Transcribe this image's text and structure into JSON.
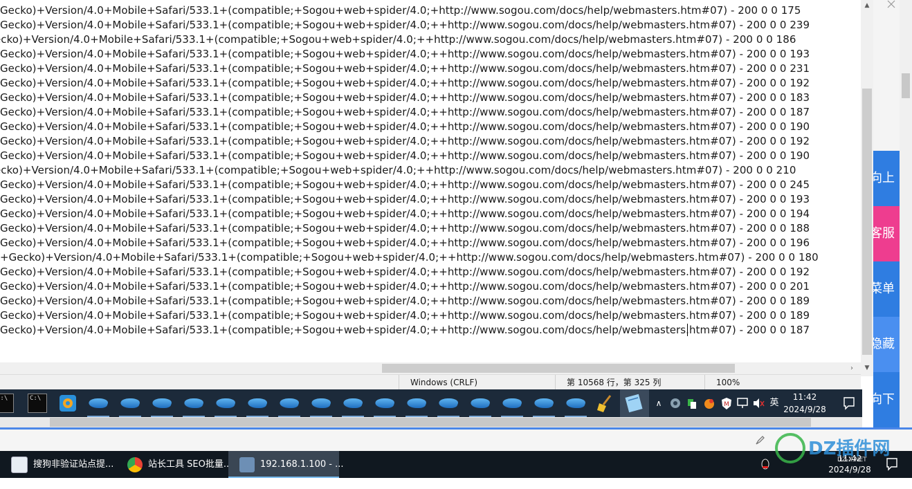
{
  "editor": {
    "lines": [
      {
        "text": "Gecko)+Version/4.0+Mobile+Safari/533.1+(compatible;+Sogou+web+spider/4.0;+http://www.sogou.com/docs/help/webmasters.htm#07) - 200 0 0 175"
      },
      {
        "text": "Gecko)+Version/4.0+Mobile+Safari/533.1+(compatible;+Sogou+web+spider/4.0;++http://www.sogou.com/docs/help/webmasters.htm#07) - 200 0 0 239"
      },
      {
        "text": "ecko)+Version/4.0+Mobile+Safari/533.1+(compatible;+Sogou+web+spider/4.0;++http://www.sogou.com/docs/help/webmasters.htm#07) - 200 0 0 186"
      },
      {
        "text": "Gecko)+Version/4.0+Mobile+Safari/533.1+(compatible;+Sogou+web+spider/4.0;++http://www.sogou.com/docs/help/webmasters.htm#07) - 200 0 0 193"
      },
      {
        "text": "Gecko)+Version/4.0+Mobile+Safari/533.1+(compatible;+Sogou+web+spider/4.0;++http://www.sogou.com/docs/help/webmasters.htm#07) - 200 0 0 231"
      },
      {
        "text": "Gecko)+Version/4.0+Mobile+Safari/533.1+(compatible;+Sogou+web+spider/4.0;++http://www.sogou.com/docs/help/webmasters.htm#07) - 200 0 0 192"
      },
      {
        "text": "Gecko)+Version/4.0+Mobile+Safari/533.1+(compatible;+Sogou+web+spider/4.0;++http://www.sogou.com/docs/help/webmasters.htm#07) - 200 0 0 183"
      },
      {
        "text": "Gecko)+Version/4.0+Mobile+Safari/533.1+(compatible;+Sogou+web+spider/4.0;++http://www.sogou.com/docs/help/webmasters.htm#07) - 200 0 0 187"
      },
      {
        "text": "Gecko)+Version/4.0+Mobile+Safari/533.1+(compatible;+Sogou+web+spider/4.0;++http://www.sogou.com/docs/help/webmasters.htm#07) - 200 0 0 190"
      },
      {
        "text": "Gecko)+Version/4.0+Mobile+Safari/533.1+(compatible;+Sogou+web+spider/4.0;++http://www.sogou.com/docs/help/webmasters.htm#07) - 200 0 0 192"
      },
      {
        "text": "Gecko)+Version/4.0+Mobile+Safari/533.1+(compatible;+Sogou+web+spider/4.0;++http://www.sogou.com/docs/help/webmasters.htm#07) - 200 0 0 190"
      },
      {
        "text": "ecko)+Version/4.0+Mobile+Safari/533.1+(compatible;+Sogou+web+spider/4.0;++http://www.sogou.com/docs/help/webmasters.htm#07) - 200 0 0 210"
      },
      {
        "text": "Gecko)+Version/4.0+Mobile+Safari/533.1+(compatible;+Sogou+web+spider/4.0;++http://www.sogou.com/docs/help/webmasters.htm#07) - 200 0 0 245"
      },
      {
        "text": "Gecko)+Version/4.0+Mobile+Safari/533.1+(compatible;+Sogou+web+spider/4.0;++http://www.sogou.com/docs/help/webmasters.htm#07) - 200 0 0 193"
      },
      {
        "text": "Gecko)+Version/4.0+Mobile+Safari/533.1+(compatible;+Sogou+web+spider/4.0;++http://www.sogou.com/docs/help/webmasters.htm#07) - 200 0 0 194"
      },
      {
        "text": "Gecko)+Version/4.0+Mobile+Safari/533.1+(compatible;+Sogou+web+spider/4.0;++http://www.sogou.com/docs/help/webmasters.htm#07) - 200 0 0 188"
      },
      {
        "text": "Gecko)+Version/4.0+Mobile+Safari/533.1+(compatible;+Sogou+web+spider/4.0;++http://www.sogou.com/docs/help/webmasters.htm#07) - 200 0 0 196"
      },
      {
        "text": "+Gecko)+Version/4.0+Mobile+Safari/533.1+(compatible;+Sogou+web+spider/4.0;++http://www.sogou.com/docs/help/webmasters.htm#07) - 200 0 0 180"
      },
      {
        "text": "Gecko)+Version/4.0+Mobile+Safari/533.1+(compatible;+Sogou+web+spider/4.0;++http://www.sogou.com/docs/help/webmasters.htm#07) - 200 0 0 192"
      },
      {
        "text": "Gecko)+Version/4.0+Mobile+Safari/533.1+(compatible;+Sogou+web+spider/4.0;++http://www.sogou.com/docs/help/webmasters.htm#07) - 200 0 0 201"
      },
      {
        "text": "Gecko)+Version/4.0+Mobile+Safari/533.1+(compatible;+Sogou+web+spider/4.0;++http://www.sogou.com/docs/help/webmasters.htm#07) - 200 0 0 189"
      },
      {
        "text": "Gecko)+Version/4.0+Mobile+Safari/533.1+(compatible;+Sogou+web+spider/4.0;++http://www.sogou.com/docs/help/webmasters.htm#07) - 200 0 0 189"
      },
      {
        "text": "Gecko)+Version/4.0+Mobile+Safari/533.1+(compatible;+Sogou+web+spider/4.0;++http://www.sogou.com/docs/help/webmasters.htm#07) - 200 0 0 187"
      }
    ]
  },
  "statusbar": {
    "line_ending": "Windows (CRLF)",
    "position": "第 10568 行，第 325 列",
    "zoom": "100%"
  },
  "inner_taskbar": {
    "ime": "英",
    "time": "11:42",
    "date": "2024/9/28"
  },
  "side_panel": {
    "buttons": [
      {
        "label": "向上",
        "color": "#2f7de1"
      },
      {
        "label": "客服",
        "color": "#ee3d8f"
      },
      {
        "label": "菜单",
        "color": "#2f7de1"
      },
      {
        "label": "隐藏",
        "color": "#4a8ff0"
      },
      {
        "label": "向下",
        "color": "#2f7de1"
      }
    ]
  },
  "outer_taskbar": {
    "tasks": [
      {
        "label": "搜狗非验证站点提..."
      },
      {
        "label": "站长工具 SEO批量..."
      },
      {
        "label": "192.168.1.100 - ..."
      }
    ],
    "time": "11:42",
    "date": "2024/9/28"
  },
  "watermark": {
    "text": "DZ插件网",
    "sub": "DZ-X.NET"
  },
  "colors": {
    "accent": "#4a86e8",
    "taskbar_dark": "#101820"
  }
}
